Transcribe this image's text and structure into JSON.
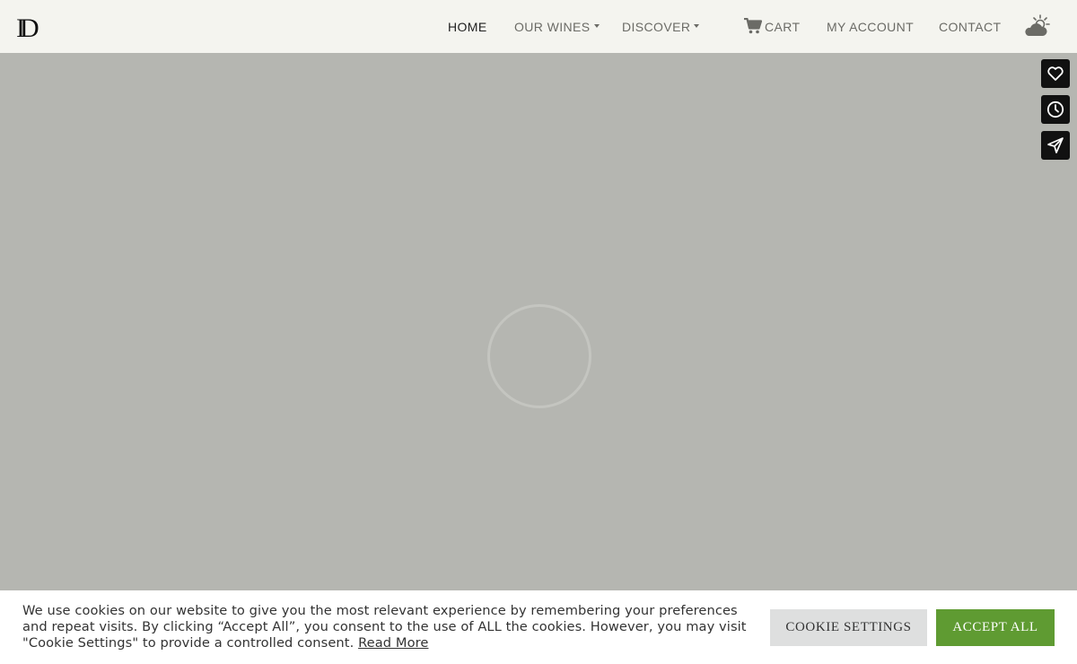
{
  "header": {
    "logo_text": "D",
    "nav": {
      "home": "HOME",
      "our_wines": "OUR WINES",
      "discover": "DISCOVER",
      "cart": "CART",
      "my_account": "MY ACCOUNT",
      "contact": "CONTACT"
    },
    "icons": {
      "cart": "cart-icon",
      "weather": "partly-cloudy-icon"
    }
  },
  "side_buttons": [
    {
      "icon": "heart-icon"
    },
    {
      "icon": "clock-icon"
    },
    {
      "icon": "send-icon"
    }
  ],
  "loader": {
    "icon": "loading-spinner-icon"
  },
  "cookie": {
    "text": "We use cookies on our website to give you the most relevant experience by remembering your preferences and repeat visits. By clicking “Accept All”, you consent to the use of ALL the cookies. However, you may visit \"Cookie Settings\" to provide a controlled consent.",
    "read_more": "Read More",
    "settings_label": "COOKIE SETTINGS",
    "accept_label": "ACCEPT ALL"
  },
  "colors": {
    "header_bg": "#f4f4ef",
    "page_bg": "#b5b6b1",
    "accept_green": "#5f9b32",
    "side_btn_bg": "#111111"
  }
}
